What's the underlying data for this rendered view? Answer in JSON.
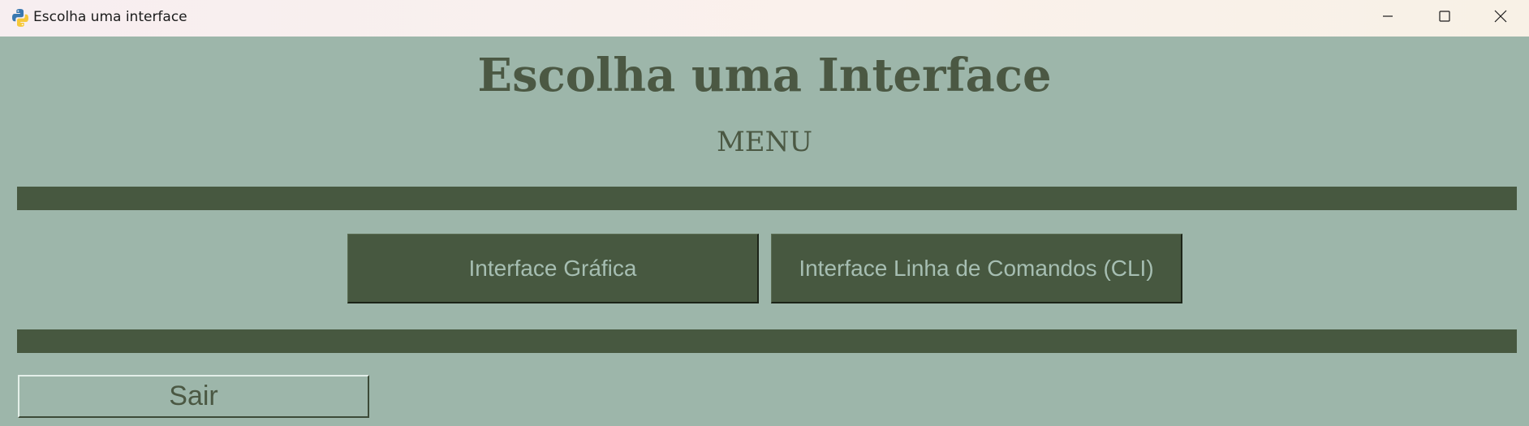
{
  "window": {
    "title": "Escolha uma interface",
    "app_icon": "python-icon",
    "controls": {
      "minimize_icon": "minimize-icon",
      "maximize_icon": "maximize-icon",
      "close_icon": "close-icon"
    }
  },
  "main": {
    "heading": "Escolha uma Interface",
    "subheading": "MENU",
    "buttons": [
      {
        "label": "Interface Gráfica"
      },
      {
        "label": "Interface Linha de Comandos (CLI)"
      }
    ],
    "exit_label": "Sair"
  },
  "colors": {
    "background": "#9db6aa",
    "dark_green": "#475840",
    "text_green": "#4b5843",
    "button_text": "#a6beb2"
  }
}
